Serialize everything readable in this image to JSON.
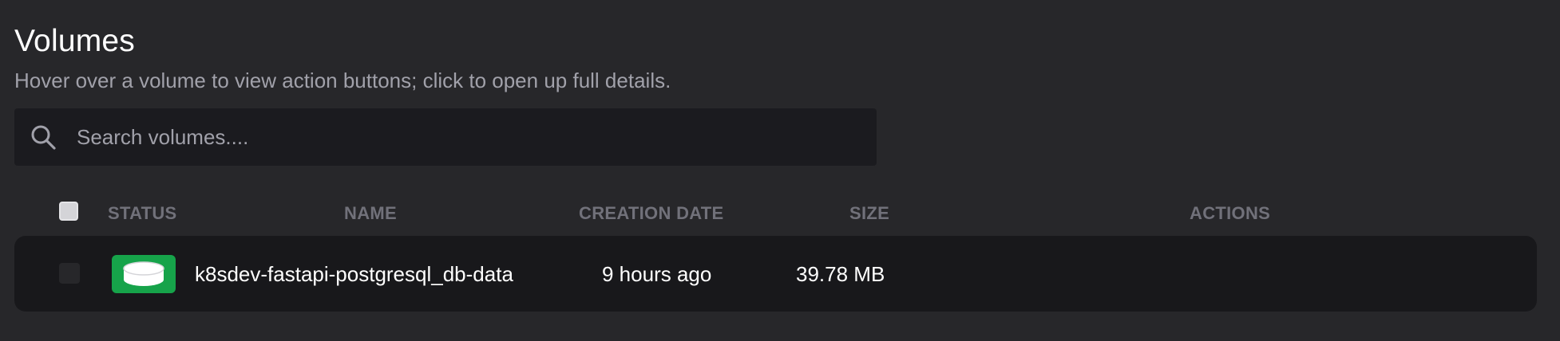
{
  "header": {
    "title": "Volumes",
    "subtitle": "Hover over a volume to view action buttons; click to open up full details."
  },
  "search": {
    "placeholder": "Search volumes....",
    "value": "",
    "icon": "search-icon"
  },
  "table": {
    "columns": {
      "status": "STATUS",
      "name": "NAME",
      "creation_date": "CREATION DATE",
      "size": "SIZE",
      "actions": "ACTIONS"
    },
    "rows": [
      {
        "status_icon": "volume-disk-icon",
        "status_color": "#16a34a",
        "name": "k8sdev-fastapi-postgresql_db-data",
        "creation_date": "9 hours ago",
        "size": "39.78 MB",
        "selected": false
      }
    ]
  },
  "colors": {
    "background": "#27272a",
    "panel": "#18181b",
    "accent_green": "#16a34a"
  }
}
